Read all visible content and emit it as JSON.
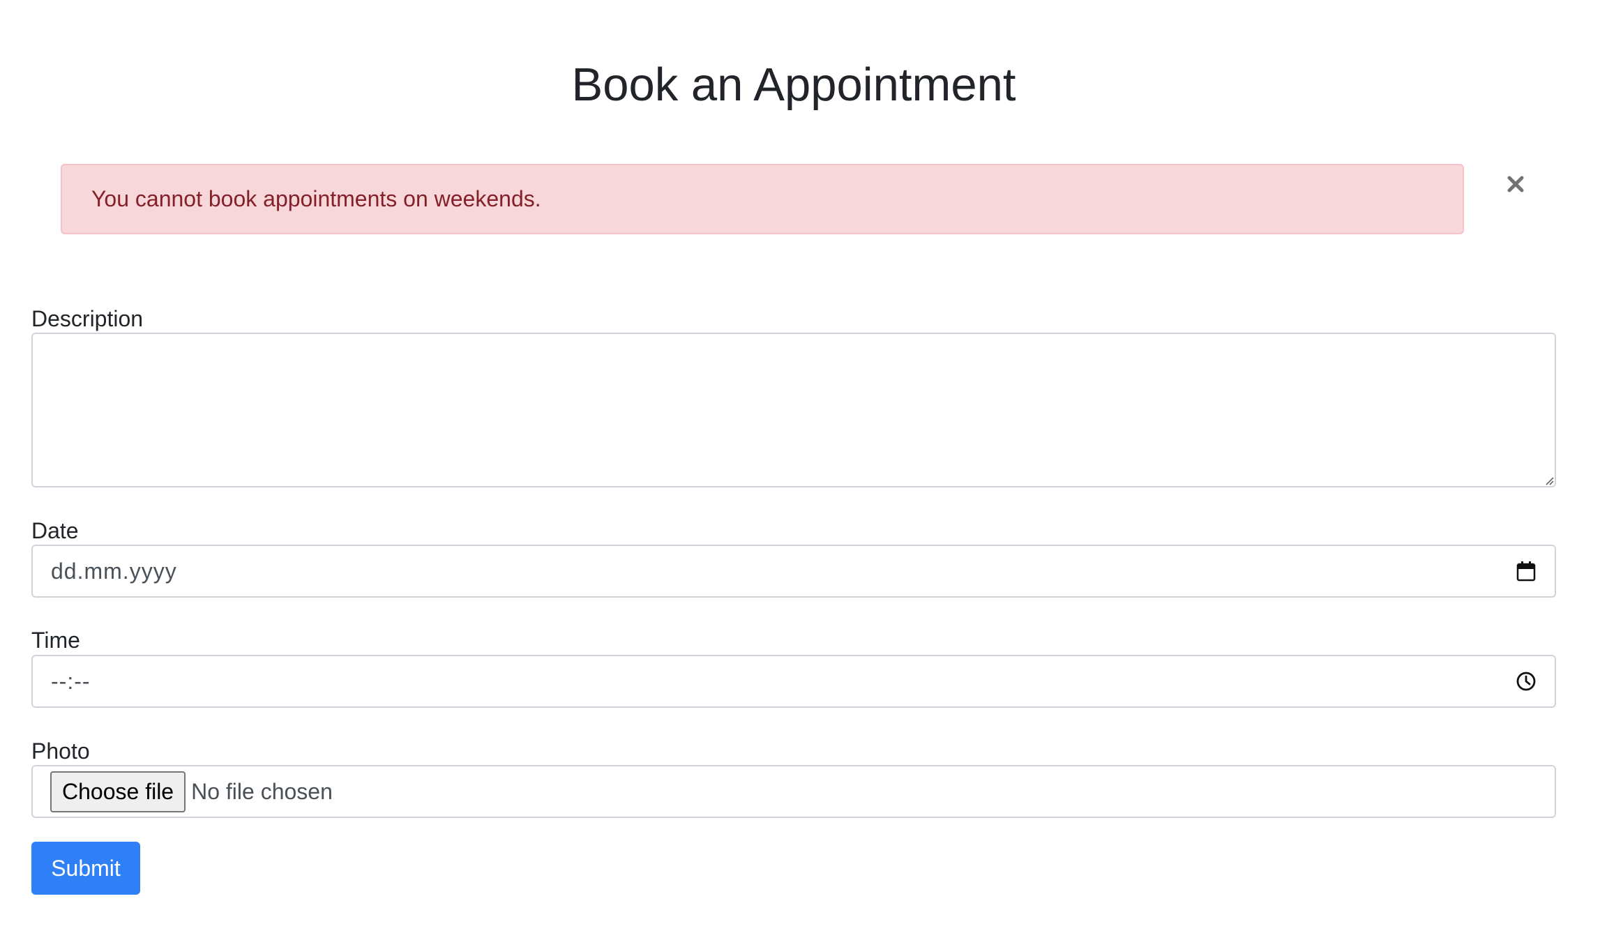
{
  "page": {
    "title": "Book an Appointment"
  },
  "alert": {
    "message": "You cannot book appointments on weekends.",
    "close_icon": "close-icon",
    "colors": {
      "background": "#f8d7da",
      "border": "#f5c2c7",
      "text": "#842029"
    }
  },
  "form": {
    "description": {
      "label": "Description",
      "value": ""
    },
    "date": {
      "label": "Date",
      "placeholder": "dd.mm.yyyy",
      "icon": "calendar-icon"
    },
    "time": {
      "label": "Time",
      "placeholder": "--:--",
      "icon": "clock-icon"
    },
    "photo": {
      "label": "Photo",
      "button_label": "Choose file",
      "status": "No file chosen"
    },
    "submit_label": "Submit"
  },
  "colors": {
    "primary": "#2f80f6",
    "text": "#212529",
    "border": "#ced4da"
  }
}
